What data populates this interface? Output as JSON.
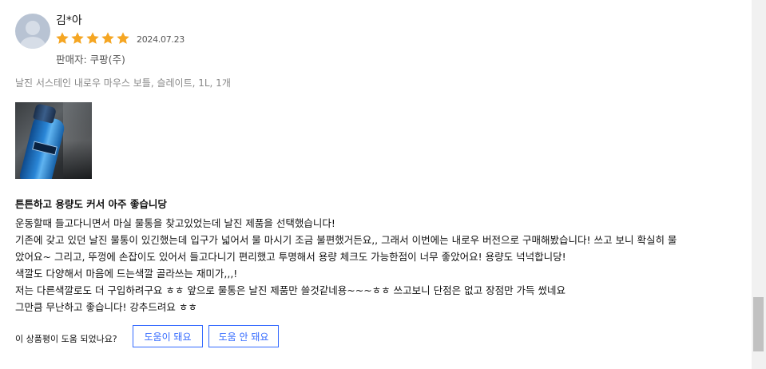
{
  "reviewer": {
    "name": "김*아"
  },
  "rating": {
    "stars": 5,
    "max": 5,
    "date": "2024.07.23"
  },
  "seller": "판매자: 쿠팡(주)",
  "product_option": "날진 서스테인 내로우 마우스 보틀, 슬레이트, 1L, 1개",
  "headline": "튼튼하고 용량도 커서 아주 좋습니당",
  "body_lines": [
    "운동할때 들고다니면서 마실 물통을 찾고있었는데 날진 제품을 선택했습니다!",
    "기존에 갖고 있던 날진 물통이 있긴했는데 입구가 넓어서 물 마시기 조금 불편했거든요,, 그래서 이번에는 내로우 버전으로 구매해봤습니다! 쓰고 보니 확실히 물",
    "았어요~ 그리고, 뚜껑에 손잡이도 있어서 들고다니기 편리했고 투명해서 용량 체크도 가능한점이 너무 좋았어요! 용량도 넉넉합니당!",
    "색깔도 다양해서 마음에 드는색깔 골라쓰는 재미가,,,!",
    "저는 다른색깔로도 더 구입하려구요 ㅎㅎ 앞으로 물통은 날진 제품만 쓸것같네용~~~ㅎㅎ 쓰고보니 단점은 없고 장점만 가득 썼네요",
    "그만큼 무난하고 좋습니다! 강추드려요 ㅎㅎ"
  ],
  "helpful": {
    "question": "이 상품평이 도움 되었나요?",
    "yes_label": "도움이 돼요",
    "no_label": "도움 안 돼요"
  },
  "colors": {
    "star": "#f5a623",
    "accent": "#346aff"
  }
}
